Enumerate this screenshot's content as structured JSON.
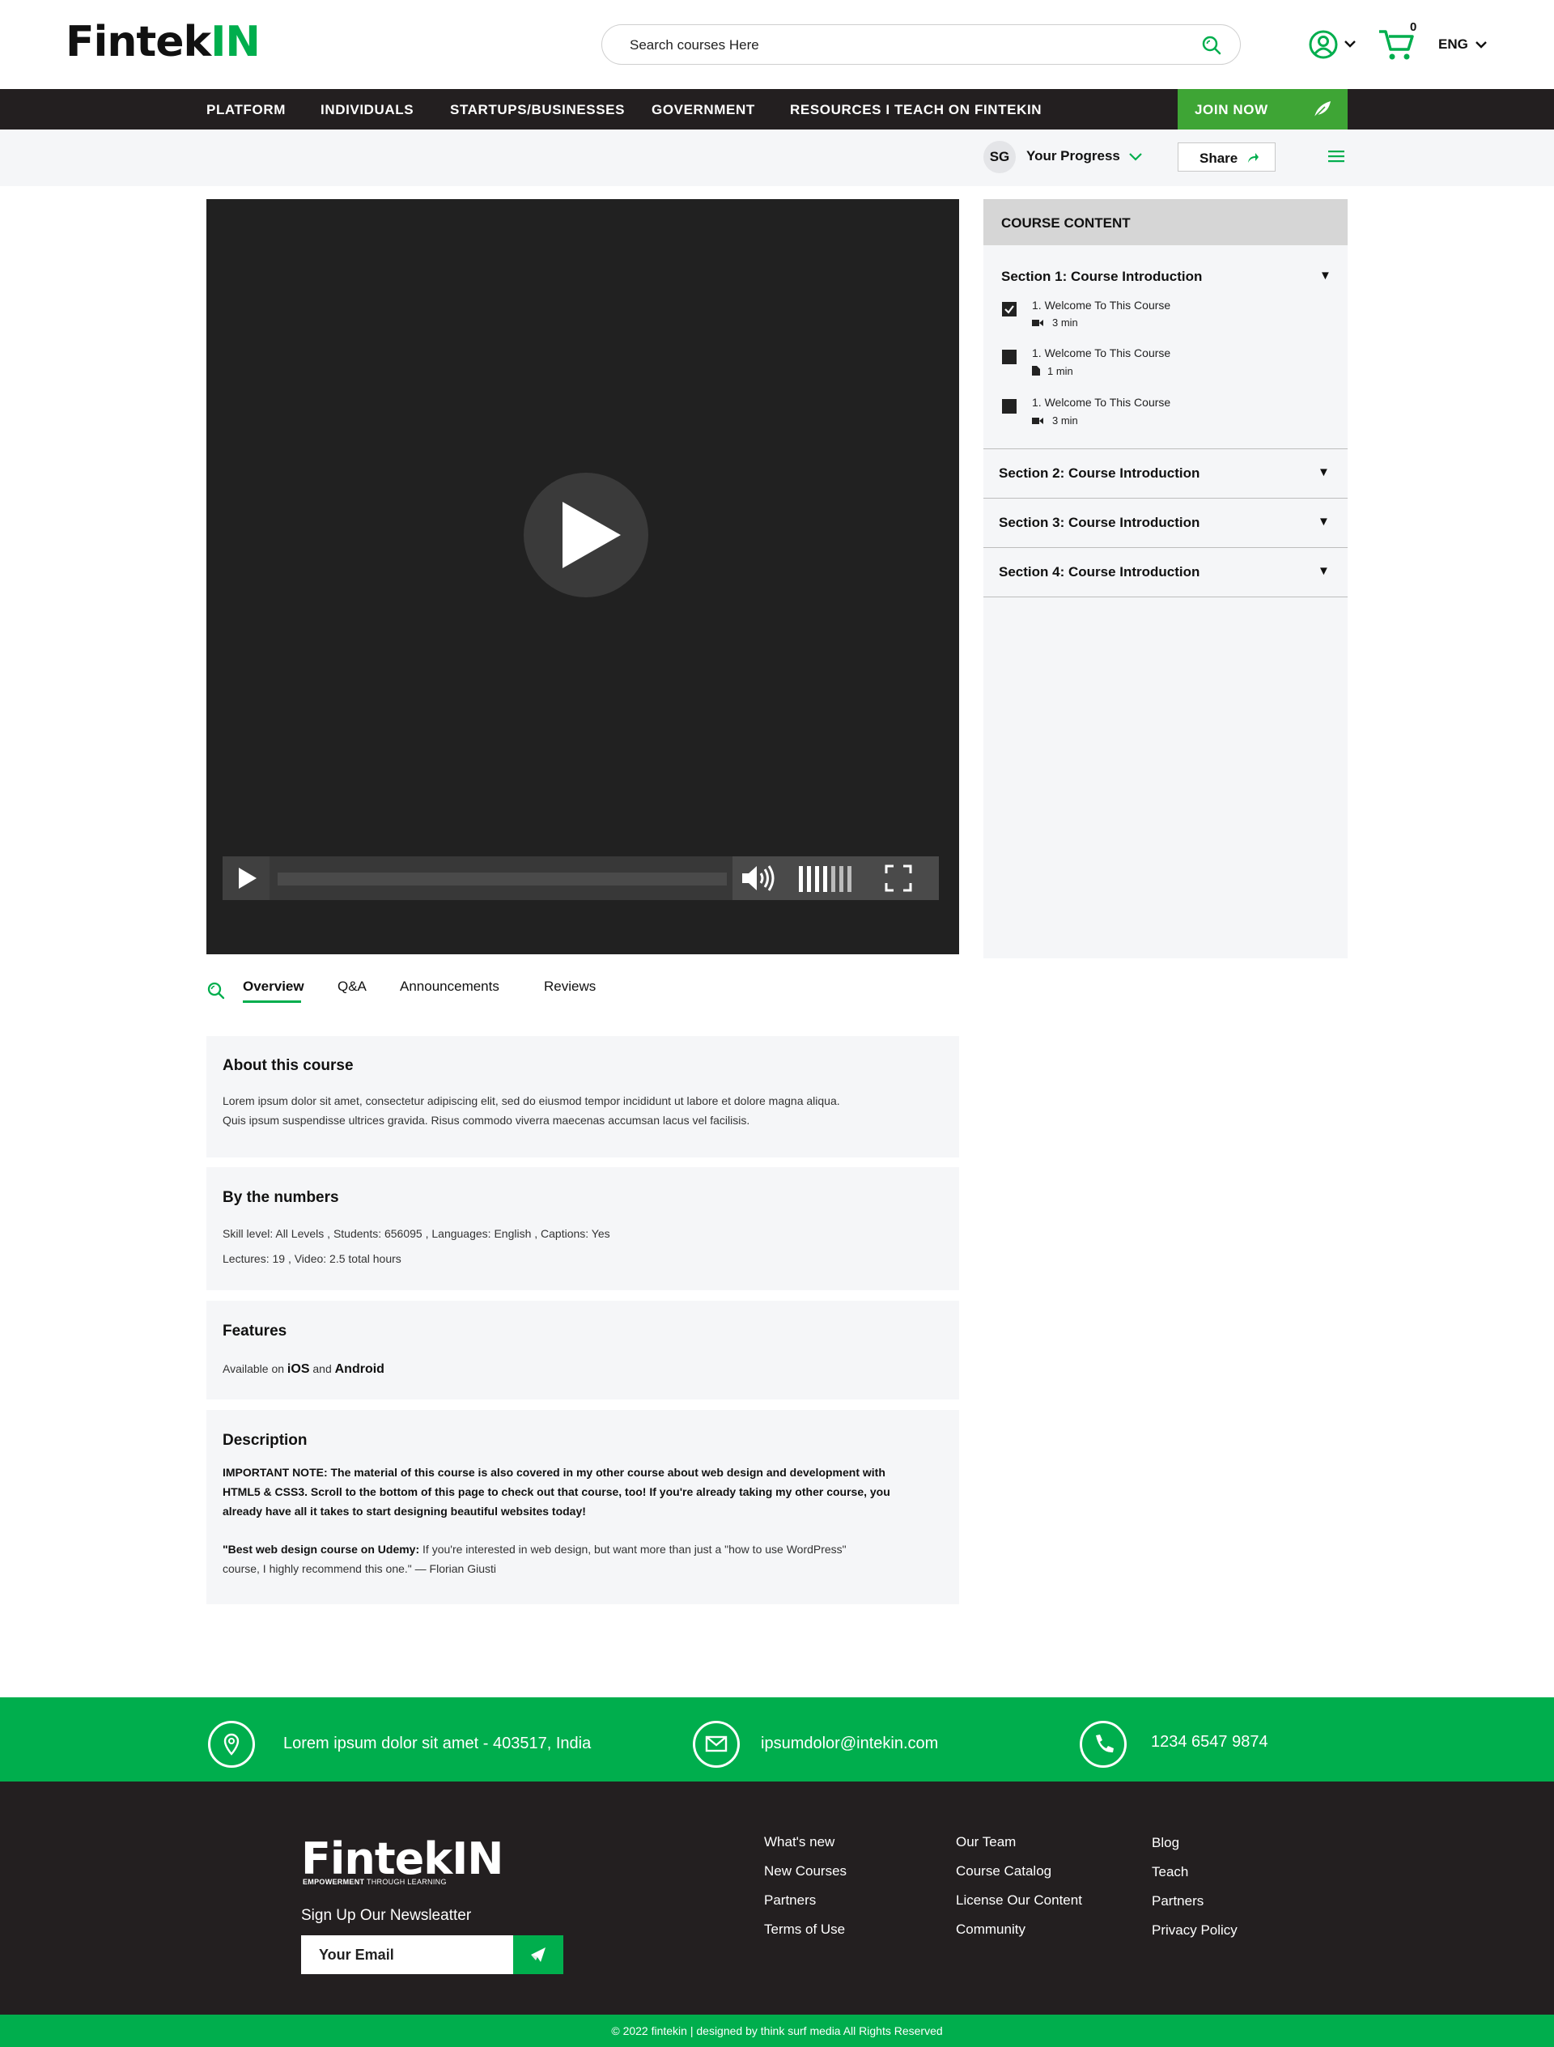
{
  "header": {
    "logo_main": "Fintek",
    "logo_accent": "IN",
    "search_placeholder": "Search courses Here",
    "cart_count": "0",
    "language": "ENG"
  },
  "nav": {
    "items": [
      "PLATFORM",
      "INDIVIDUALS",
      "STARTUPS/BUSINESSES",
      "GOVERNMENT",
      "RESOURCES I TEACH ON FINTEKIN"
    ],
    "join_label": "JOIN NOW"
  },
  "progress": {
    "initials": "SG",
    "label": "Your Progress",
    "share_label": "Share"
  },
  "course_content": {
    "header": "COURSE CONTENT",
    "sections": [
      {
        "title": "Section 1: Course Introduction",
        "lessons": [
          {
            "title": "1. Welcome To This Course",
            "duration": "3 min",
            "type": "video",
            "checked": true
          },
          {
            "title": "1. Welcome To This Course",
            "duration": "1 min",
            "type": "document",
            "checked": false
          },
          {
            "title": "1. Welcome To This Course",
            "duration": "3 min",
            "type": "video",
            "checked": false
          }
        ]
      },
      {
        "title": "Section 2: Course Introduction"
      },
      {
        "title": "Section 3: Course Introduction"
      },
      {
        "title": "Section 4: Course Introduction"
      }
    ]
  },
  "tabs": [
    "Overview",
    "Q&A",
    "Announcements",
    "Reviews"
  ],
  "about": {
    "title": "About this course",
    "line1": "Lorem ipsum dolor sit amet, consectetur adipiscing elit, sed do eiusmod tempor incididunt ut labore et dolore magna aliqua.",
    "line2": "Quis ipsum suspendisse ultrices gravida. Risus commodo viverra maecenas accumsan lacus vel facilisis."
  },
  "numbers": {
    "title": "By the numbers",
    "line1": "Skill level: All Levels , Students: 656095 , Languages: English , Captions: Yes",
    "line2": "Lectures: 19 , Video: 2.5 total hours"
  },
  "features": {
    "title": "Features",
    "prefix": "Available on ",
    "ios": "iOS",
    "and": " and ",
    "android": "Android"
  },
  "description": {
    "title": "Description",
    "note_line1": "IMPORTANT NOTE: The material of this course is also covered in my other course about web design and development with",
    "note_line2": "HTML5 & CSS3. Scroll to the bottom of this page to check out that course, too! If you're already taking my other course, you",
    "note_line3": "already have all it takes to start designing beautiful websites today!",
    "quote_bold": "\"Best web design course on Udemy:",
    "quote_rest": " If you're interested in web design, but want more than just a \"how to use WordPress\"",
    "quote_line2": "course, I highly recommend this one.\" — Florian Giusti"
  },
  "contact": {
    "address": "Lorem ipsum dolor sit amet - 403517, India",
    "email": "ipsumdolor@intekin.com",
    "phone": "1234 6547 9874"
  },
  "footer": {
    "logo": "FintekIN",
    "tagline_bold": "EMPOWERMENT",
    "tagline_rest": " THROUGH LEARNING",
    "newsletter_label": "Sign Up Our Newsleatter",
    "email_placeholder": "Your Email",
    "col1": [
      "What's new",
      "New Courses",
      "Partners",
      "Terms of Use"
    ],
    "col2": [
      "Our Team",
      "Course Catalog",
      "License Our Content",
      "Community"
    ],
    "col3": [
      "Blog",
      "Teach",
      "Partners",
      "Privacy Policy"
    ],
    "copyright": "© 2022 fintekin | designed by think surf media All Rights Reserved"
  },
  "colors": {
    "brand_green": "#00ae4d",
    "join_green": "#3ea535",
    "dark": "#231f20"
  },
  "icons": [
    "search-icon",
    "user-icon",
    "cart-icon",
    "chevron-down-icon",
    "leaf-icon",
    "share-arrow-icon",
    "menu-icon",
    "play-icon",
    "volume-icon",
    "fullscreen-icon",
    "location-icon",
    "mail-icon",
    "phone-icon",
    "send-icon",
    "video-icon",
    "document-icon"
  ]
}
